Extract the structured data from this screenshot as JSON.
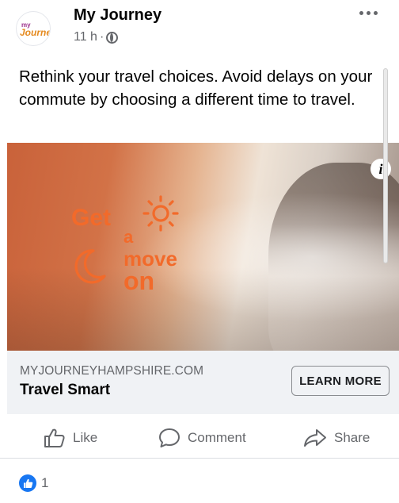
{
  "post": {
    "page_name": "My Journey",
    "avatar_logo_top": "my",
    "avatar_logo_main": "Journey",
    "time": "11 h",
    "separator": "·",
    "text": "Rethink your travel choices. Avoid delays on your commute by choosing a different time to travel.",
    "more_icon": "more-dots-icon",
    "privacy_icon": "globe-icon"
  },
  "ad": {
    "headline_get": "Get",
    "headline_a": "a",
    "headline_move": "move",
    "headline_on": "on",
    "info_label": "i",
    "accent_color": "#f26a2a"
  },
  "link": {
    "domain": "MYJOURNEYHAMPSHIRE.COM",
    "title": "Travel Smart",
    "cta": "LEARN MORE"
  },
  "actions": {
    "like": "Like",
    "comment": "Comment",
    "share": "Share"
  },
  "reactions": {
    "count": "1",
    "icon": "thumbs-up-icon",
    "color": "#1877f2"
  }
}
